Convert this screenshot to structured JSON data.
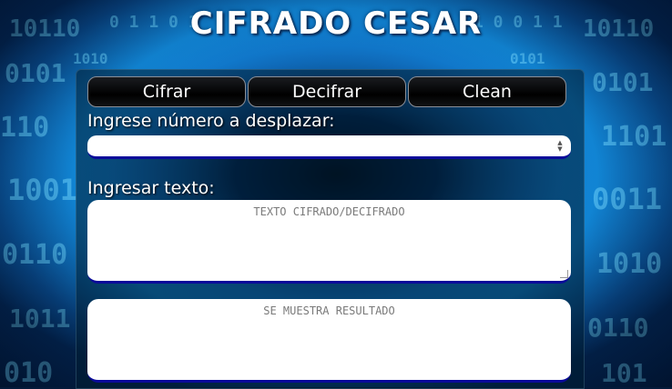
{
  "page": {
    "title": "CIFRADO CESAR"
  },
  "toolbar": {
    "buttons": [
      {
        "label": "Cifrar"
      },
      {
        "label": "Decifrar"
      },
      {
        "label": "Clean"
      }
    ]
  },
  "form": {
    "shift_label": "Ingrese número a desplazar:",
    "shift_value": "",
    "text_label": "Ingresar texto:",
    "input_placeholder": "TEXTO CIFRADO/DECIFRADO",
    "output_placeholder": "SE MUESTRA RESULTADO"
  },
  "colors": {
    "accent_border": "#0a0a9a",
    "button_bg": "#000000",
    "text_light": "#ffffff"
  }
}
